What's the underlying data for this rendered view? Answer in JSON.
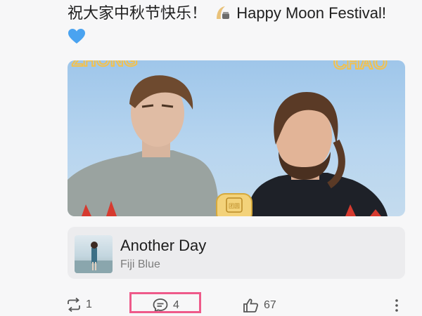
{
  "post": {
    "text": "祝大家中秋节快乐！",
    "text_en": "Happy Moon Festival!",
    "emoji_moon": "moon-cake-emoji",
    "emoji_heart": "blue-heart-emoji"
  },
  "image_overlay": {
    "left_text": "ZHONG",
    "right_text": "CHAO",
    "cake_text": "团圆"
  },
  "music": {
    "title": "Another Day",
    "artist": "Fiji Blue"
  },
  "actions": {
    "repost_count": "1",
    "comment_count": "4",
    "like_count": "67"
  },
  "colors": {
    "highlight": "#ee5a8a",
    "accent_heart": "#4aa3f0"
  }
}
